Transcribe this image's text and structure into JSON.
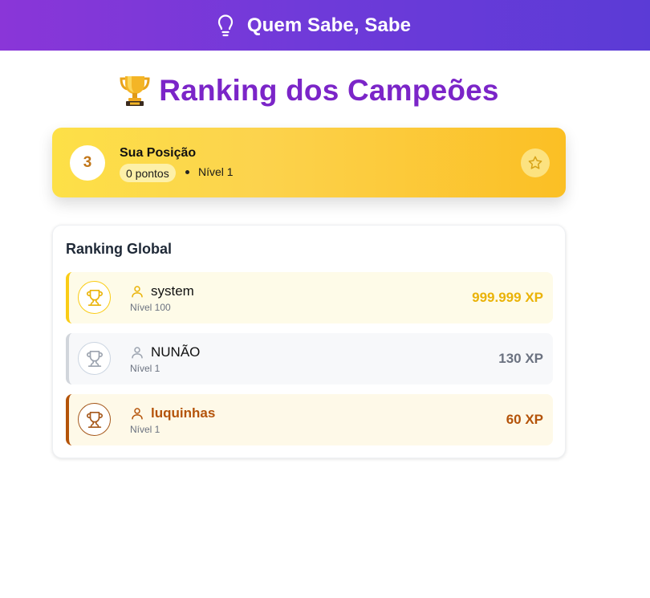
{
  "header": {
    "title": "Quem Sabe, Sabe",
    "icon": "lightbulb-icon"
  },
  "page": {
    "title": "Ranking dos Campeões",
    "title_icon": "trophy-icon"
  },
  "user_position": {
    "rank": "3",
    "heading": "Sua Posição",
    "points": "0 pontos",
    "level": "Nível 1",
    "star_icon": "star-icon"
  },
  "ranking": {
    "heading": "Ranking Global",
    "entries": [
      {
        "name": "system",
        "level": "Nível 100",
        "xp": "999.999 XP",
        "tier": "gold"
      },
      {
        "name": "NUNÃO",
        "level": "Nível 1",
        "xp": "130 XP",
        "tier": "silver"
      },
      {
        "name": "luquinhas",
        "level": "Nível 1",
        "xp": "60 XP",
        "tier": "bronze"
      }
    ]
  },
  "colors": {
    "header_gradient_start": "#8a36d8",
    "header_gradient_end": "#5b3bd6",
    "title_purple": "#7b25c8",
    "gold": "#eab308",
    "silver": "#6b7280",
    "bronze": "#b45309"
  }
}
